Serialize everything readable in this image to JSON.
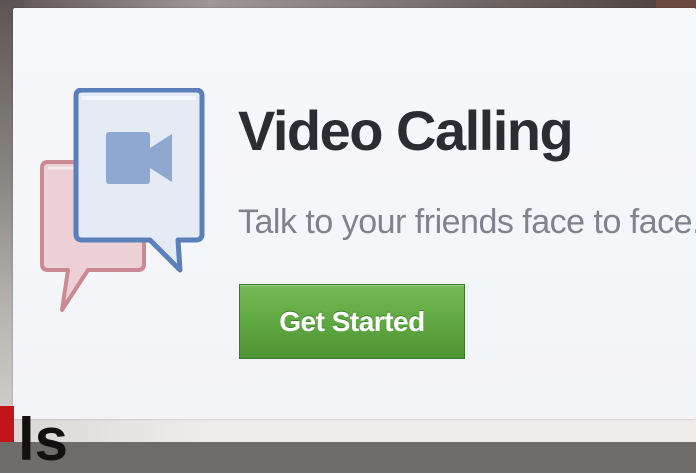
{
  "dialog": {
    "title": "Video Calling",
    "subtitle": "Talk to your friends face to face.",
    "button_label": "Get Started",
    "illustration_icon": "video-chat-bubbles-icon",
    "accent_colors": {
      "button_green": "#5ea640",
      "front_bubble_border": "#5a7fb9",
      "front_bubble_fill": "#e4ebf5",
      "camera_fill": "#8ea8cf",
      "back_bubble_border": "#c98a93",
      "back_bubble_fill": "#ecd0d6"
    }
  },
  "background": {
    "partial_text": "ls"
  }
}
